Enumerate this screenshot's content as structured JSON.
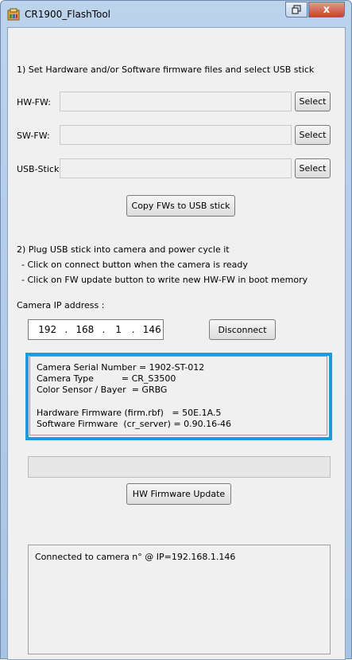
{
  "window": {
    "title": "CR1900_FlashTool",
    "close_glyph": "x",
    "colors": {
      "highlight": "#1e9bd7",
      "close": "#c4442e"
    }
  },
  "step1": {
    "instruction": "1) Set Hardware and/or Software firmware files and select USB stick",
    "hw_label": "HW-FW:",
    "hw_value": "",
    "sw_label": "SW-FW:",
    "sw_value": "",
    "usb_label": "USB-Stick:",
    "usb_value": "",
    "select_label": "Select",
    "copy_button": "Copy FWs to USB stick"
  },
  "step2": {
    "instruction": "2) Plug USB stick into camera and power cycle it",
    "hint1": "- Click on connect button when the camera is ready",
    "hint2": "- Click on FW update button to write new HW-FW in boot memory",
    "ip_label": "Camera IP address :",
    "ip": [
      "192",
      "168",
      "1",
      "146"
    ],
    "ip_sep": ".",
    "disconnect_button": "Disconnect"
  },
  "camera_info": {
    "lines": [
      "Camera Serial Number = 1902-ST-012",
      "Camera Type          = CR_S3500",
      "Color Sensor / Bayer  = GRBG",
      "",
      "Hardware Firmware (firm.rbf)   = 50E.1A.5",
      "Software Firmware  (cr_server) = 0.90.16-46"
    ]
  },
  "update": {
    "progress": 0,
    "button": "HW Firmware Update"
  },
  "log": {
    "text": "Connected to camera n° @ IP=192.168.1.146"
  }
}
